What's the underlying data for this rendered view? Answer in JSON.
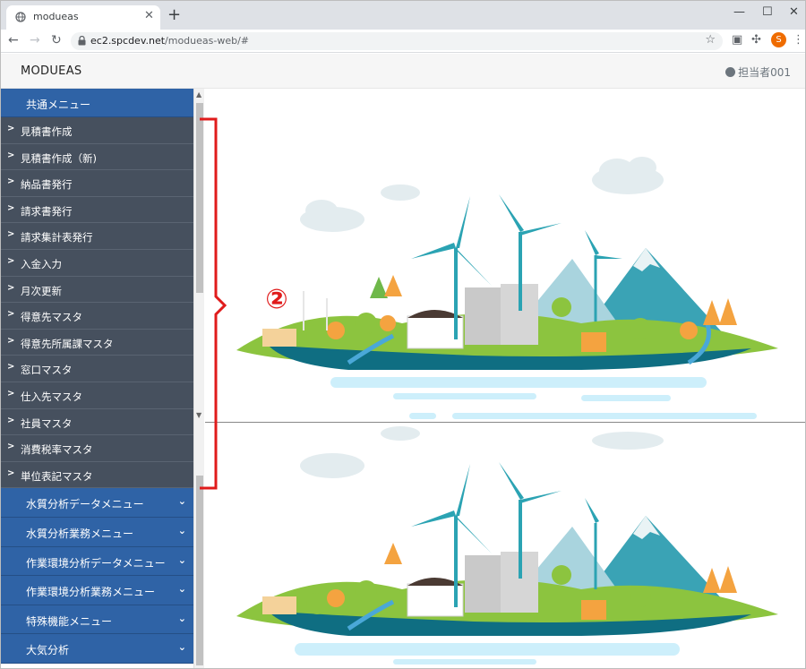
{
  "browser": {
    "tab_title": "modueas",
    "url_host": "ec2.spcdev.net",
    "url_path": "/modueas-web/#",
    "profile_initial": "S"
  },
  "app": {
    "brand": "MODUEAS",
    "user_label": "担当者001"
  },
  "sidebar": {
    "common_menu": "共通メニュー",
    "items": [
      {
        "label": "見積書作成"
      },
      {
        "label": "見積書作成（新)"
      },
      {
        "label": "納品書発行"
      },
      {
        "label": "請求書発行"
      },
      {
        "label": "請求集計表発行"
      },
      {
        "label": "入金入力"
      },
      {
        "label": "月次更新"
      },
      {
        "label": "得意先マスタ"
      },
      {
        "label": "得意先所属課マスタ"
      },
      {
        "label": "窓口マスタ"
      },
      {
        "label": "仕入先マスタ"
      },
      {
        "label": "社員マスタ"
      },
      {
        "label": "消費税率マスタ"
      },
      {
        "label": "単位表記マスタ"
      }
    ],
    "groups": [
      {
        "label": "水質分析データメニュー"
      },
      {
        "label": "水質分析業務メニュー"
      },
      {
        "label": "作業環境分析データメニュー"
      },
      {
        "label": "作業環境分析業務メニュー"
      },
      {
        "label": "特殊機能メニュー"
      },
      {
        "label": "大気分析"
      }
    ]
  },
  "annotation": {
    "number": "②",
    "color": "#e01b1b"
  },
  "colors": {
    "menu_blue": "#2f63a6",
    "submenu_gray": "#46505e"
  }
}
